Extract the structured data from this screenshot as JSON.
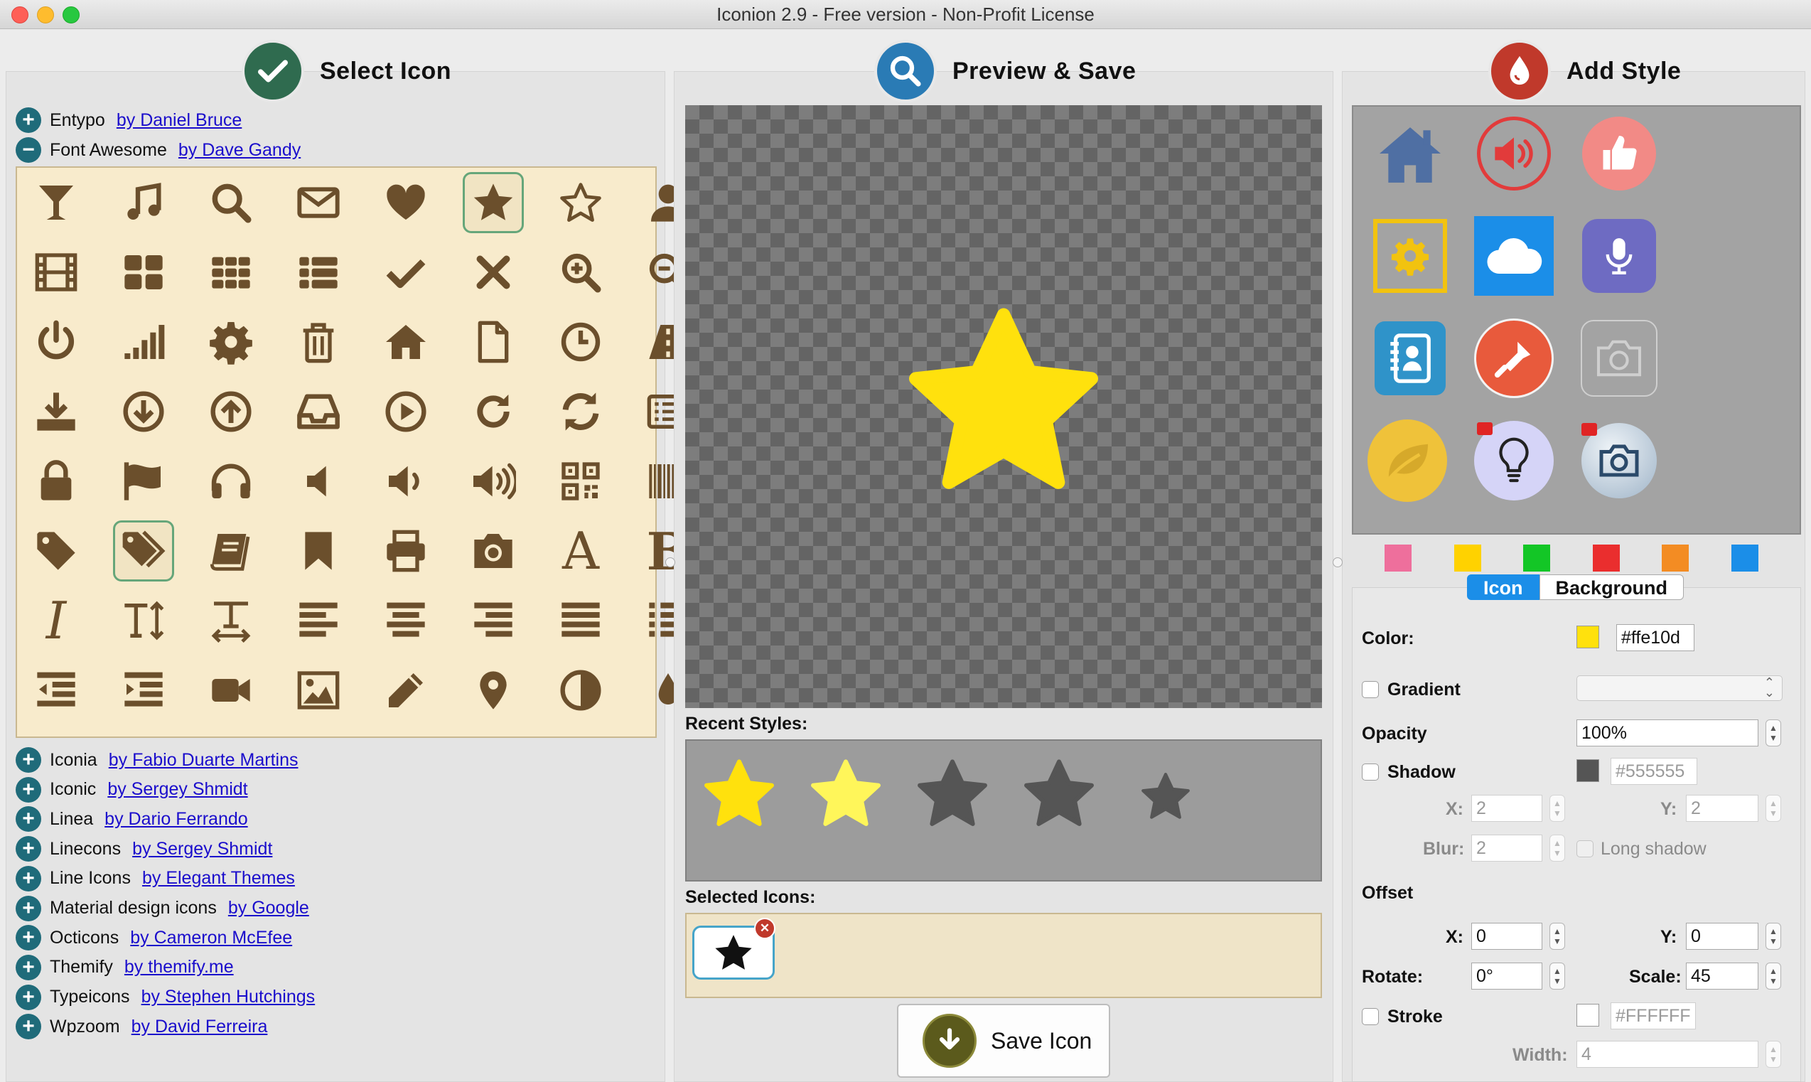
{
  "window": {
    "title": "Iconion 2.9 - Free version - Non-Profit License"
  },
  "sections": {
    "select": "Select Icon",
    "preview": "Preview & Save",
    "style": "Add Style"
  },
  "libraries_top": [
    {
      "name": "Entypo",
      "author": "by Daniel Bruce",
      "expanded": false
    },
    {
      "name": "Font Awesome",
      "author": "by Dave Gandy",
      "expanded": true
    }
  ],
  "libraries_bottom": [
    {
      "name": "Iconia",
      "author": "by Fabio Duarte Martins"
    },
    {
      "name": "Iconic",
      "author": "by Sergey Shmidt"
    },
    {
      "name": "Linea",
      "author": "by Dario Ferrando"
    },
    {
      "name": "Linecons",
      "author": "by Sergey Shmidt"
    },
    {
      "name": "Line Icons",
      "author": "by Elegant Themes"
    },
    {
      "name": "Material design icons",
      "author": "by Google"
    },
    {
      "name": "Octicons",
      "author": "by Cameron McEfee"
    },
    {
      "name": "Themify",
      "author": "by themify.me"
    },
    {
      "name": "Typeicons",
      "author": "by Stephen Hutchings"
    },
    {
      "name": "Wpzoom",
      "author": "by David Ferreira"
    }
  ],
  "icon_grid": [
    "glass-icon",
    "music-icon",
    "search-icon",
    "envelope-icon",
    "heart-icon",
    "star-icon",
    "star-outline-icon",
    "user-icon",
    "film-icon",
    "th-large-icon",
    "th-icon",
    "th-list-icon",
    "check-icon",
    "times-icon",
    "zoom-in-icon",
    "zoom-out-icon",
    "power-icon",
    "signal-icon",
    "gear-icon",
    "trash-icon",
    "home-icon",
    "file-icon",
    "clock-icon",
    "road-icon",
    "download-icon",
    "arrow-circle-down-icon",
    "arrow-circle-up-icon",
    "inbox-icon",
    "play-circle-icon",
    "repeat-icon",
    "refresh-icon",
    "list-alt-icon",
    "lock-icon",
    "flag-icon",
    "headphones-icon",
    "volume-off-icon",
    "volume-down-icon",
    "volume-up-icon",
    "qrcode-icon",
    "barcode-icon",
    "tag-icon",
    "tags-icon",
    "book-icon",
    "bookmark-icon",
    "print-icon",
    "camera-icon",
    "font-icon",
    "bold-icon",
    "italic-icon",
    "text-height-icon",
    "text-width-icon",
    "align-left-icon",
    "align-center-icon",
    "align-right-icon",
    "align-justify-icon",
    "list-icon",
    "outdent-icon",
    "indent-icon",
    "video-camera-icon",
    "picture-icon",
    "pencil-icon",
    "map-marker-icon",
    "adjust-icon",
    "tint-icon"
  ],
  "icon_grid_text": {
    "font": "A",
    "bold": "B",
    "italic": "I"
  },
  "selected_grid_icons": [
    "star-icon",
    "tags-icon"
  ],
  "preview": {
    "icon": "star-icon",
    "color": "#ffe10d"
  },
  "recent_styles": {
    "label": "Recent Styles:",
    "items": [
      {
        "color": "#ffe10d"
      },
      {
        "color": "#fff65a"
      },
      {
        "color": "#555555"
      },
      {
        "color": "#555555"
      },
      {
        "color": "#555555"
      }
    ]
  },
  "selected_icons": {
    "label": "Selected Icons:",
    "items": [
      "star-icon"
    ]
  },
  "save": {
    "label": "Save Icon"
  },
  "style_gallery": [
    "home-style",
    "speaker-style",
    "thumbs-up-style",
    "gear-style",
    "cloud-style",
    "microphone-style",
    "address-book-style",
    "flashlight-style",
    "camera-outline-style",
    "leaf-style",
    "lightbulb-locked-style",
    "camera-locked-style"
  ],
  "swatches": [
    "#ee6f9c",
    "#ffd200",
    "#13c626",
    "#ea2e2e",
    "#f38c23",
    "#1b8ee8"
  ],
  "tabs": {
    "icon": "Icon",
    "background": "Background"
  },
  "form": {
    "color_label": "Color:",
    "color_value": "#ffe10d",
    "color_swatch": "#ffe10d",
    "gradient_label": "Gradient",
    "opacity_label": "Opacity",
    "opacity_value": "100%",
    "shadow_label": "Shadow",
    "shadow_value": "#555555",
    "shadow_swatch": "#555555",
    "x_label": "X:",
    "y_label": "Y:",
    "shadow_x": "2",
    "shadow_y": "2",
    "blur_label": "Blur:",
    "blur_value": "2",
    "long_shadow_label": "Long shadow",
    "offset_label": "Offset",
    "offset_x": "0",
    "offset_y": "0",
    "rotate_label": "Rotate:",
    "rotate_value": "0°",
    "scale_label": "Scale:",
    "scale_value": "45",
    "stroke_label": "Stroke",
    "stroke_value": "#FFFFFF",
    "width_label": "Width:",
    "width_value": "4"
  },
  "colors": {
    "accent": "#1b8ee8",
    "icon_brown": "#6b4f2c",
    "link": "#1a0dcc"
  }
}
